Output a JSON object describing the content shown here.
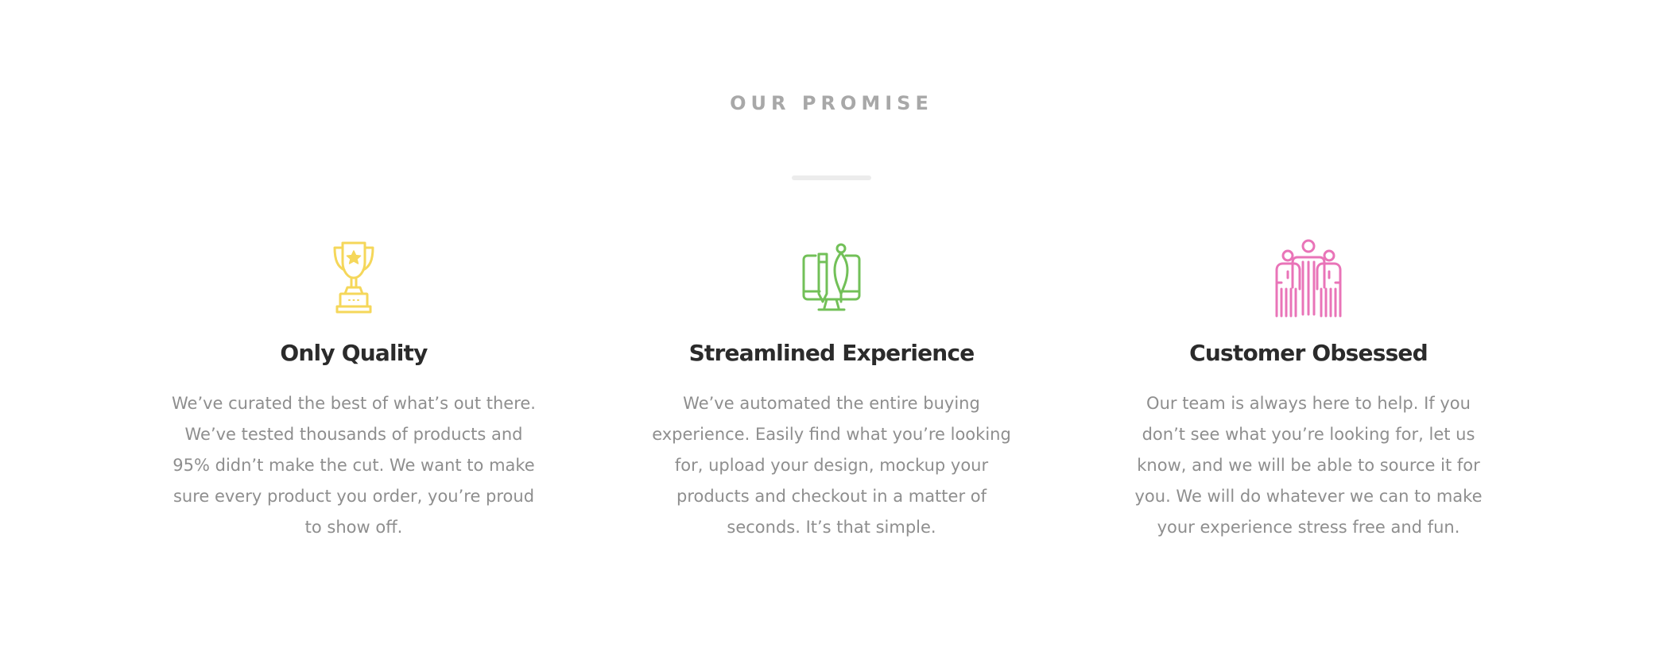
{
  "section": {
    "eyebrow": "OUR PROMISE"
  },
  "features": [
    {
      "icon": "trophy-icon",
      "icon_color": "#f5d75a",
      "title": "Only Quality",
      "text": "We’ve curated the best of what’s out there. We’ve tested thousands of products and 95% didn’t make the cut. We want to make sure every product you order, you’re proud to show off."
    },
    {
      "icon": "design-tools-monitor-icon",
      "icon_color": "#72c058",
      "title": "Streamlined Experience",
      "text": "We’ve automated the entire buying experience. Easily find what you’re looking for, upload your design, mockup your products and checkout in a matter of seconds. It’s that simple."
    },
    {
      "icon": "team-icon",
      "icon_color": "#e974b8",
      "title": "Customer Obsessed",
      "text": "Our team is always here to help. If you don’t see what you’re looking for, let us know, and we will be able to source it for you. We will do whatever we can to make your experience stress free and fun."
    }
  ]
}
